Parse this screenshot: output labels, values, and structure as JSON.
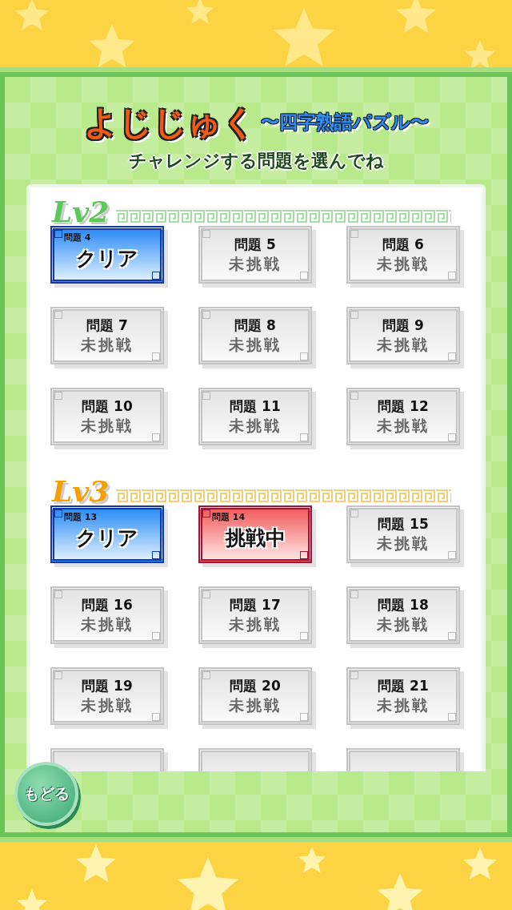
{
  "title": {
    "logo": "よじじゅく",
    "subtitle": "〜四字熟語パズル〜"
  },
  "instruction": "チャレンジする問題を選んでね",
  "sections": [
    {
      "level": "Lv2",
      "color": "#5cc85a",
      "problems": [
        {
          "kind": "clear",
          "label": "問題 4",
          "state_text": "クリア"
        },
        {
          "kind": "untried",
          "label": "問題 5",
          "state_text": "未挑戦"
        },
        {
          "kind": "untried",
          "label": "問題 6",
          "state_text": "未挑戦"
        },
        {
          "kind": "untried",
          "label": "問題 7",
          "state_text": "未挑戦"
        },
        {
          "kind": "untried",
          "label": "問題 8",
          "state_text": "未挑戦"
        },
        {
          "kind": "untried",
          "label": "問題 9",
          "state_text": "未挑戦"
        },
        {
          "kind": "untried",
          "label": "問題 10",
          "state_text": "未挑戦"
        },
        {
          "kind": "untried",
          "label": "問題 11",
          "state_text": "未挑戦"
        },
        {
          "kind": "untried",
          "label": "問題 12",
          "state_text": "未挑戦"
        }
      ]
    },
    {
      "level": "Lv3",
      "color": "#f5a000",
      "problems": [
        {
          "kind": "clear",
          "label": "問題 13",
          "state_text": "クリア"
        },
        {
          "kind": "challenging",
          "label": "問題 14",
          "state_text": "挑戦中"
        },
        {
          "kind": "untried",
          "label": "問題 15",
          "state_text": "未挑戦"
        },
        {
          "kind": "untried",
          "label": "問題 16",
          "state_text": "未挑戦"
        },
        {
          "kind": "untried",
          "label": "問題 17",
          "state_text": "未挑戦"
        },
        {
          "kind": "untried",
          "label": "問題 18",
          "state_text": "未挑戦"
        },
        {
          "kind": "untried",
          "label": "問題 19",
          "state_text": "未挑戦"
        },
        {
          "kind": "untried",
          "label": "問題 20",
          "state_text": "未挑戦"
        },
        {
          "kind": "untried",
          "label": "問題 21",
          "state_text": "未挑戦"
        },
        {
          "kind": "cut"
        },
        {
          "kind": "cut"
        },
        {
          "kind": "cut"
        }
      ]
    }
  ],
  "back_button": "もどる"
}
